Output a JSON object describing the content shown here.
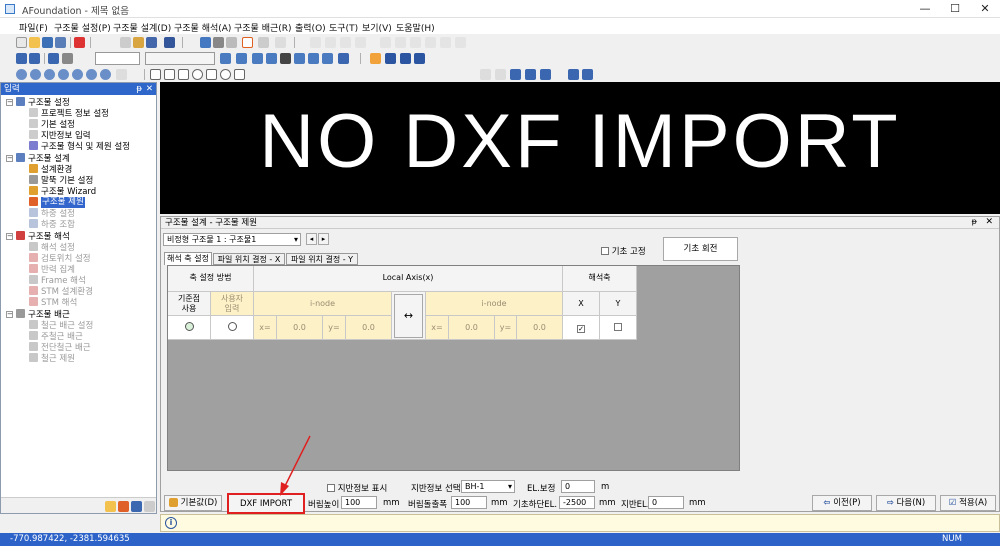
{
  "window": {
    "title": "AFoundation - 제목 없음",
    "min": "—",
    "max": "☐",
    "close": "✕"
  },
  "menu": [
    "파일(F)",
    "구조물 설정(P)",
    "구조물 설계(D)",
    "구조물 해석(A)",
    "구조물 배근(R)",
    "출력(O)",
    "도구(T)",
    "보기(V)",
    "도움말(H)"
  ],
  "left_panel": {
    "title": "입력",
    "pin": "ᵽ",
    "close": "✕",
    "groups": [
      {
        "label": "구조물 설정",
        "items": [
          "프로젝트 정보 설정",
          "기본 설정",
          "지반정보 입력",
          "구조물 형식 및 제원 설정"
        ]
      },
      {
        "label": "구조물 설계",
        "items": [
          "설계환경",
          "말뚝 기본 설정",
          "구조물 Wizard",
          "구조물 제원",
          "하중 설정",
          "하중 조합"
        ]
      },
      {
        "label": "구조물 해석",
        "items": [
          "해석 설정",
          "검토위치 설정",
          "반력 집계",
          "Frame 해석",
          "STM 설계환경",
          "STM 해석"
        ]
      },
      {
        "label": "구조물 배근",
        "items": [
          "철근 배근 설정",
          "주철근 배근",
          "전단철근 배근",
          "철근 제원"
        ]
      }
    ],
    "selected": "구조물 제원"
  },
  "canvas": {
    "message": "NO DXF IMPORT"
  },
  "panel": {
    "title": "구조물 설계 - 구조물 제원",
    "structure_select": "비정형 구조물 1 : 구조물1",
    "fix_checkbox": "기초 고정",
    "rotate_button": "기초 회전",
    "tabs": [
      "해석 축 설정",
      "파일 위치 결정 - X",
      "파일 위치 결정 - Y"
    ],
    "table": {
      "h_method": "축 설정 방법",
      "h_local": "Local Axis(x)",
      "h_axis": "해석축",
      "sub_base": "기준점\n사용",
      "sub_user": "사용자\n입력",
      "sub_inode1": "i-node",
      "sub_inode2": "i-node",
      "sub_x": "X",
      "sub_y": "Y",
      "x_label": "x=",
      "y_label": "y=",
      "x1": "0.0",
      "y1": "0.0",
      "x2": "0.0",
      "y2": "0.0",
      "swap": "↔"
    },
    "ground_info_chk": "지반정보 표시",
    "ground_select_label": "지반정보 선택",
    "ground_select": "BH-1",
    "el_label": "EL.보정",
    "el_value": "0",
    "el_unit": "m",
    "btn_default": "기본값(D)",
    "btn_dxf": "DXF IMPORT",
    "berm_h_label": "버림높이",
    "berm_h": "100",
    "berm_h_unit": "mm",
    "berm_w_label": "버림돌출폭",
    "berm_w": "100",
    "berm_w_unit": "mm",
    "base_el_label": "기초하단EL.",
    "base_el": "-2500",
    "base_el_unit": "mm",
    "ground_el_label": "지반EL.",
    "ground_el": "0",
    "ground_el_unit": "mm",
    "btn_prev": "이전(P)",
    "btn_next": "다음(N)",
    "btn_apply": "적용(A)"
  },
  "status": {
    "coords": "-770.987422,   -2381.594635",
    "num": "NUM"
  },
  "colors": {
    "accent": "#2f66c9",
    "annot": "#e02020",
    "grid_input": "#fdf1c8"
  }
}
